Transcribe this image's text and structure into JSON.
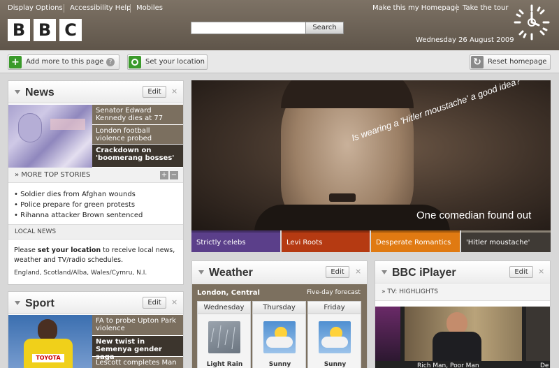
{
  "header": {
    "links_left": [
      "Display Options",
      "Accessibility Help",
      "Mobiles"
    ],
    "links_right": [
      "Make this my Homepage",
      "Take the tour"
    ],
    "logo_letters": [
      "B",
      "B",
      "C"
    ],
    "search_button": "Search",
    "date": "Wednesday 26 August 2009"
  },
  "toolbar": {
    "add_more": "Add more to this page",
    "help_glyph": "?",
    "set_location": "Set your location",
    "reset": "Reset homepage"
  },
  "news": {
    "title": "News",
    "edit": "Edit",
    "close": "×",
    "headlines": [
      "Senator Edward Kennedy dies at 77",
      "London football violence probed",
      "Crackdown on 'boomerang bosses'"
    ],
    "more_stories": "MORE TOP STORIES",
    "stories": [
      "Soldier dies from Afghan wounds",
      "Police prepare for green protests",
      "Rihanna attacker Brown sentenced"
    ],
    "local_title": "LOCAL NEWS",
    "local_prefix": "Please ",
    "local_link": "set your location",
    "local_suffix": " to receive local news, weather and TV/radio schedules.",
    "regions": "England, Scotland/Alba, Wales/Cymru, N.I."
  },
  "sport": {
    "title": "Sport",
    "edit": "Edit",
    "close": "×",
    "headlines": [
      "FA to probe Upton Park violence",
      "New twist in Semenya gender saga",
      "Lescott completes Man"
    ],
    "bib_text": "TOYOTA"
  },
  "feature": {
    "caption_angled": "Is wearing a 'Hitler moustache' a good idea?",
    "caption_bottom": "One comedian found out",
    "tabs": [
      {
        "label": "Strictly celebs",
        "color": "#5b3f8a"
      },
      {
        "label": "Levi Roots",
        "color": "#b53a12"
      },
      {
        "label": "Desperate Romantics",
        "color": "#e07a12"
      },
      {
        "label": "'Hitler moustache'",
        "color": "#3f3a35"
      }
    ]
  },
  "weather": {
    "title": "Weather",
    "edit": "Edit",
    "close": "×",
    "location": "London, Central",
    "forecast_link": "Five-day forecast",
    "days": [
      {
        "name": "Wednesday",
        "condition": "Light Rain",
        "icon": "rain-icon"
      },
      {
        "name": "Thursday",
        "condition": "Sunny",
        "icon": "sunny-cloud-icon"
      },
      {
        "name": "Friday",
        "condition": "Sunny",
        "icon": "sunny-cloud-icon"
      }
    ]
  },
  "iplayer": {
    "title": "BBC iPlayer",
    "edit": "Edit",
    "close": "×",
    "section": "TV: HIGHLIGHTS",
    "captions": [
      "Rich Man, Poor Man",
      "De"
    ]
  },
  "colors": {
    "header_brown": "#6b6054",
    "headline_brown": "#7b6f5f",
    "headline_dark": "#3c352d",
    "weather_brown": "#7c705f"
  }
}
